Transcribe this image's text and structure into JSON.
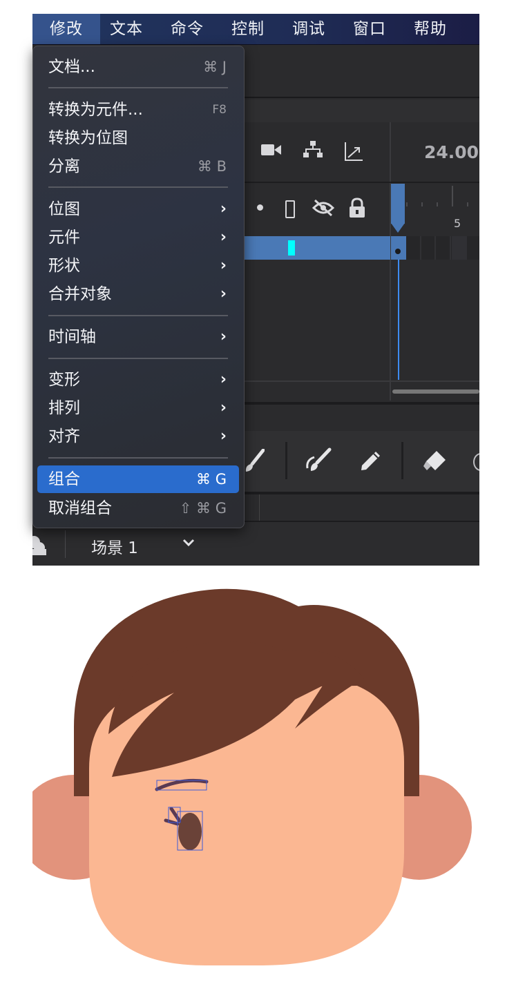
{
  "menubar": {
    "items": [
      "修改",
      "文本",
      "命令",
      "控制",
      "调试",
      "窗口",
      "帮助"
    ]
  },
  "timeline": {
    "fps": "24.00",
    "frame_marker": "5"
  },
  "scene": {
    "label": "场景 1"
  },
  "menu": {
    "document": {
      "label": "文档...",
      "shortcut": "⌘ J"
    },
    "convert_symbol": {
      "label": "转换为元件...",
      "shortcut": "F8"
    },
    "convert_bitmap": {
      "label": "转换为位图"
    },
    "break_apart": {
      "label": "分离",
      "shortcut": "⌘ B"
    },
    "bitmap": {
      "label": "位图"
    },
    "symbol": {
      "label": "元件"
    },
    "shape": {
      "label": "形状"
    },
    "combine_objects": {
      "label": "合并对象"
    },
    "timeline": {
      "label": "时间轴"
    },
    "transform": {
      "label": "变形"
    },
    "arrange": {
      "label": "排列"
    },
    "align": {
      "label": "对齐"
    },
    "group": {
      "label": "组合",
      "shortcut": "⌘ G"
    },
    "ungroup": {
      "label": "取消组合",
      "shortcut": "⇧ ⌘ G"
    }
  },
  "colors": {
    "hair": "#6b3a2a",
    "skin": "#fbb792",
    "ear": "#e2937c",
    "eye": "#6a4238",
    "menu_highlight": "#2a6ccd",
    "layer_highlight": "#4a79b6",
    "keyframe": "#00ffff"
  }
}
